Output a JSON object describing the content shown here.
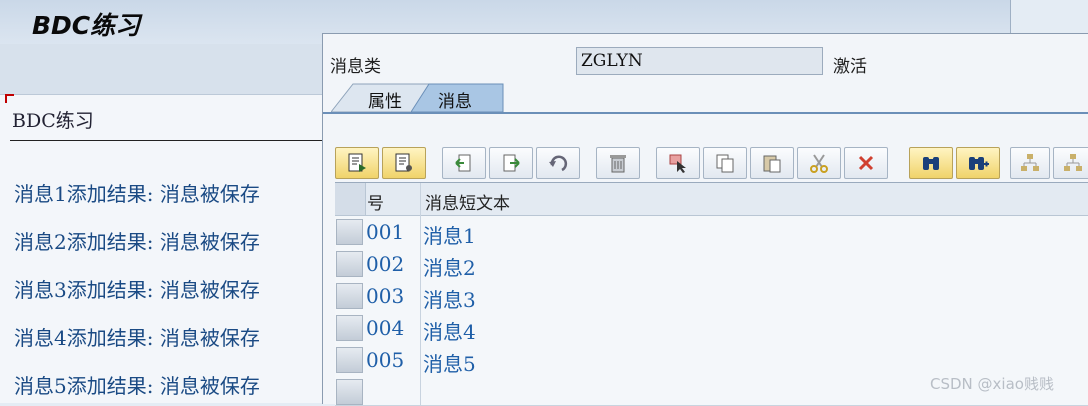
{
  "back_window": {
    "title": "BDC练习",
    "heading": "BDC练习",
    "messages": [
      "消息1添加结果: 消息被保存",
      "消息2添加结果: 消息被保存",
      "消息3添加结果: 消息被保存",
      "消息4添加结果: 消息被保存",
      "消息5添加结果: 消息被保存"
    ]
  },
  "dialog": {
    "message_class_label": "消息类",
    "message_class_value": "ZGLYN",
    "status_label": "激活",
    "tabs": [
      {
        "label": "属性",
        "active": false
      },
      {
        "label": "消息",
        "active": true
      }
    ],
    "toolbar_icons": [
      "details-icon",
      "display-icon",
      "insert-row-icon",
      "append-row-icon",
      "undo-icon",
      "delete-icon",
      "select-icon",
      "copy-icon",
      "paste-icon",
      "cut-icon",
      "delete-row-icon",
      "find-icon",
      "find-next-icon",
      "hierarchy-icon",
      "hierarchy-expand-icon"
    ],
    "table": {
      "columns": [
        "号",
        "消息短文本"
      ],
      "rows": [
        {
          "no": "001",
          "text": "消息1"
        },
        {
          "no": "002",
          "text": "消息2"
        },
        {
          "no": "003",
          "text": "消息3"
        },
        {
          "no": "004",
          "text": "消息4"
        },
        {
          "no": "005",
          "text": "消息5"
        }
      ]
    }
  },
  "watermark": "CSDN @xiao贱贱",
  "colors": {
    "accent": "#1f5fa8",
    "tab_active": "#a9c6e4",
    "highlight_button": "#f0d36a"
  }
}
